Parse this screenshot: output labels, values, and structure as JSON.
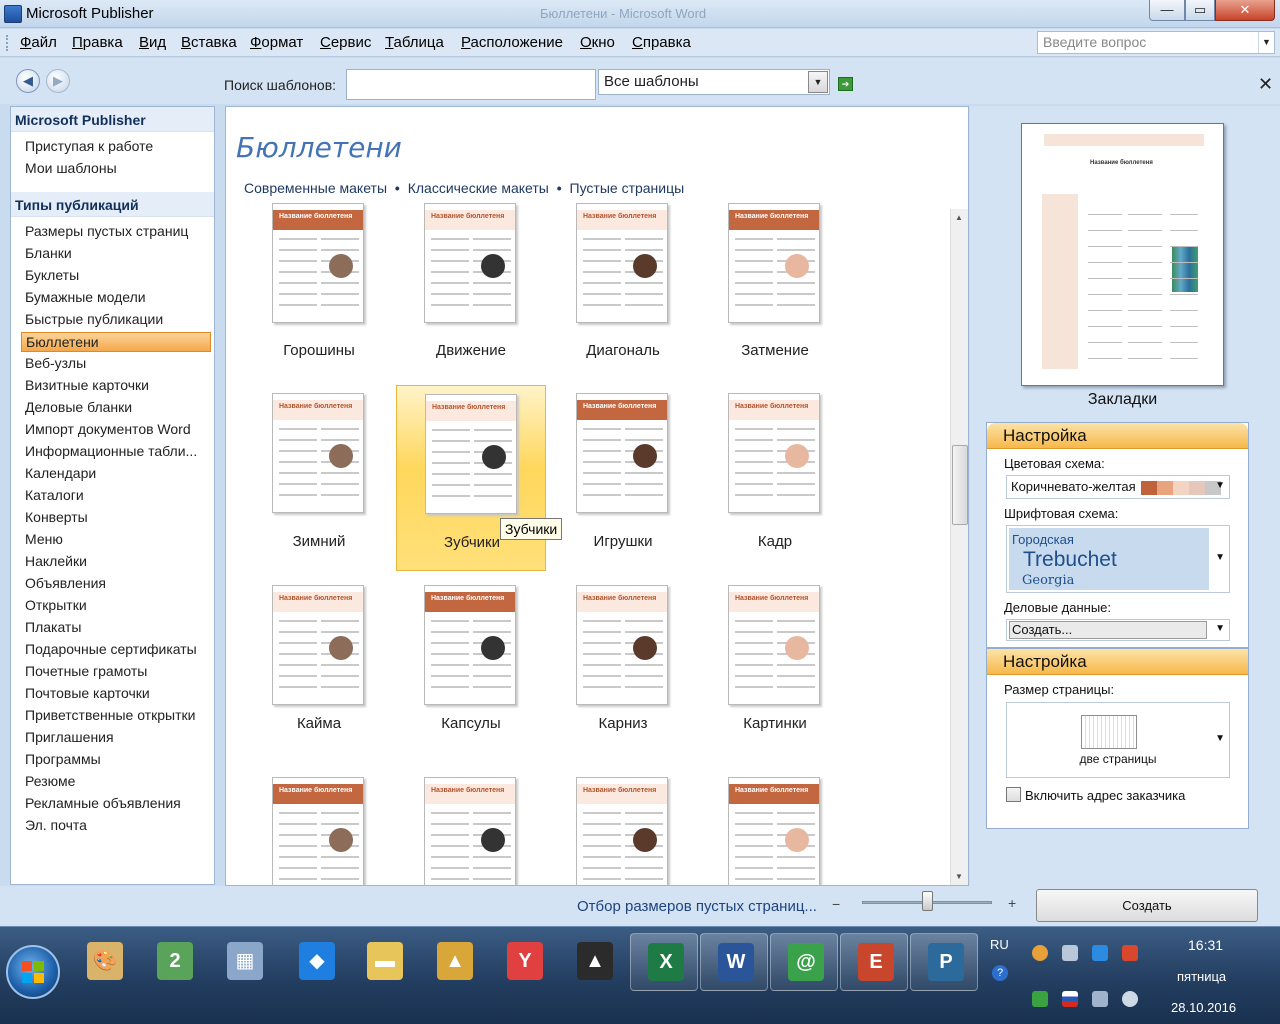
{
  "window": {
    "title": "Microsoft Publisher",
    "ghost_title": "Бюллетени - Microsoft Word",
    "controls": {
      "minimize": "—",
      "maximize": "▭",
      "close": "✕"
    }
  },
  "menu": {
    "items": [
      "Файл",
      "Правка",
      "Вид",
      "Вставка",
      "Формат",
      "Сервис",
      "Таблица",
      "Расположение",
      "Окно",
      "Справка"
    ],
    "ask_placeholder": "Введите вопрос"
  },
  "search": {
    "back_icon": "◀",
    "forward_icon": "▶",
    "label": "Поиск шаблонов:",
    "value": "",
    "scope": "Все шаблоны",
    "dropdown_icon": "▼",
    "go_icon": "➔",
    "close_icon": "✕"
  },
  "left_panel": {
    "section1_title": "Microsoft Publisher",
    "section1_items": [
      "Приступая к работе",
      "Мои шаблоны"
    ],
    "section2_title": "Типы публикаций",
    "section2_items": [
      "Размеры пустых страниц",
      "Бланки",
      "Буклеты",
      "Бумажные модели",
      "Быстрые публикации",
      "Бюллетени",
      "Веб-узлы",
      "Визитные карточки",
      "Деловые бланки",
      "Импорт документов Word",
      "Информационные табли...",
      "Календари",
      "Каталоги",
      "Конверты",
      "Меню",
      "Наклейки",
      "Объявления",
      "Открытки",
      "Плакаты",
      "Подарочные сертификаты",
      "Почетные грамоты",
      "Почтовые карточки",
      "Приветственные открытки",
      "Приглашения",
      "Программы",
      "Резюме",
      "Рекламные объявления",
      "Эл. почта"
    ],
    "selected": "Бюллетени"
  },
  "center": {
    "title": "Бюллетени",
    "filters": [
      "Современные макеты",
      "Классические макеты",
      "Пустые страницы"
    ],
    "filter_separator": "•",
    "templates": [
      {
        "name": "Горошины"
      },
      {
        "name": "Движение"
      },
      {
        "name": "Диагональ"
      },
      {
        "name": "Затмение"
      },
      {
        "name": "Зимний"
      },
      {
        "name": "Зубчики"
      },
      {
        "name": "Игрушки"
      },
      {
        "name": "Кадр"
      },
      {
        "name": "Кайма"
      },
      {
        "name": "Капсулы"
      },
      {
        "name": "Карниз"
      },
      {
        "name": "Картинки"
      },
      {
        "name": ""
      },
      {
        "name": ""
      },
      {
        "name": ""
      },
      {
        "name": ""
      }
    ],
    "selected_template": "Зубчики",
    "tooltip": "Зубчики",
    "thumb_text": {
      "title_short": "Название бюллетеня",
      "t1": "Название",
      "t2": "бюллетеня"
    },
    "scroll_up": "▲",
    "scroll_down": "▼"
  },
  "right_panel": {
    "preview_name": "Закладки",
    "preview_title": "Название бюллетеня",
    "customize1": {
      "header": "Настройка",
      "color_label": "Цветовая схема:",
      "color_value": "Коричневато-желтая",
      "color_swatches": [
        "#c0623a",
        "#e8a47c",
        "#f3d3c2",
        "#e6c7bb",
        "#c8c8c8"
      ],
      "font_label": "Шрифтовая схема:",
      "font_scheme_name": "Городская",
      "font_major": "Trebuchet",
      "font_minor": "Georgia",
      "business_label": "Деловые данные:",
      "business_value": "Создать..."
    },
    "customize2": {
      "header": "Настройка",
      "page_size_label": "Размер страницы:",
      "page_size_value": "две страницы",
      "checkbox_label": "Включить адрес заказчика",
      "checkbox_checked": false
    }
  },
  "bottom": {
    "link": "Отбор размеров пустых страниц...",
    "zoom_out": "−",
    "zoom_in": "+",
    "zoom_level": 0.5,
    "create_label": "Создать"
  },
  "taskbar": {
    "apps": [
      "paint-icon",
      "maps-icon",
      "calculator-icon",
      "dropbox-icon",
      "explorer-icon",
      "folder-icon",
      "yandex-icon",
      "aimp-icon",
      "excel-icon",
      "word-icon",
      "agent-icon",
      "powerpoint-icon",
      "publisher-icon"
    ],
    "lang": "RU",
    "time": "16:31",
    "weekday": "пятница",
    "date": "28.10.2016"
  },
  "accent": "#f4a84a",
  "brand": "#4474b5"
}
